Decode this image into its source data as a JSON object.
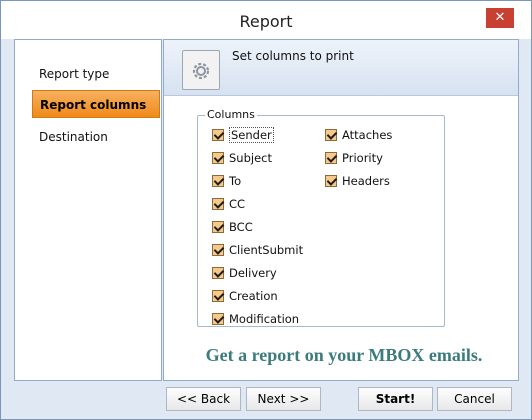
{
  "window": {
    "title": "Report",
    "close_label": "✕"
  },
  "nav": {
    "items": [
      {
        "label": "Report type",
        "active": false
      },
      {
        "label": "Report columns",
        "active": true
      },
      {
        "label": "Destination",
        "active": false
      }
    ]
  },
  "header": {
    "text": "Set columns to print",
    "icon": "gear-document-icon"
  },
  "columns": {
    "group_title": "Columns",
    "left": [
      {
        "label": "Sender",
        "checked": true
      },
      {
        "label": "Subject",
        "checked": true
      },
      {
        "label": "To",
        "checked": true
      },
      {
        "label": "CC",
        "checked": true
      },
      {
        "label": "BCC",
        "checked": true
      },
      {
        "label": "ClientSubmit",
        "checked": true
      },
      {
        "label": "Delivery",
        "checked": true
      },
      {
        "label": "Creation",
        "checked": true
      },
      {
        "label": "Modification",
        "checked": true
      }
    ],
    "right": [
      {
        "label": "Attaches",
        "checked": true
      },
      {
        "label": "Priority",
        "checked": true
      },
      {
        "label": "Headers",
        "checked": true
      }
    ]
  },
  "promo": "Get a report on your MBOX emails.",
  "buttons": {
    "back": "<< Back",
    "next": "Next >>",
    "start": "Start!",
    "cancel": "Cancel"
  },
  "colors": {
    "accent": "#f08a18",
    "promo": "#3b7b7b",
    "close": "#c84031"
  }
}
